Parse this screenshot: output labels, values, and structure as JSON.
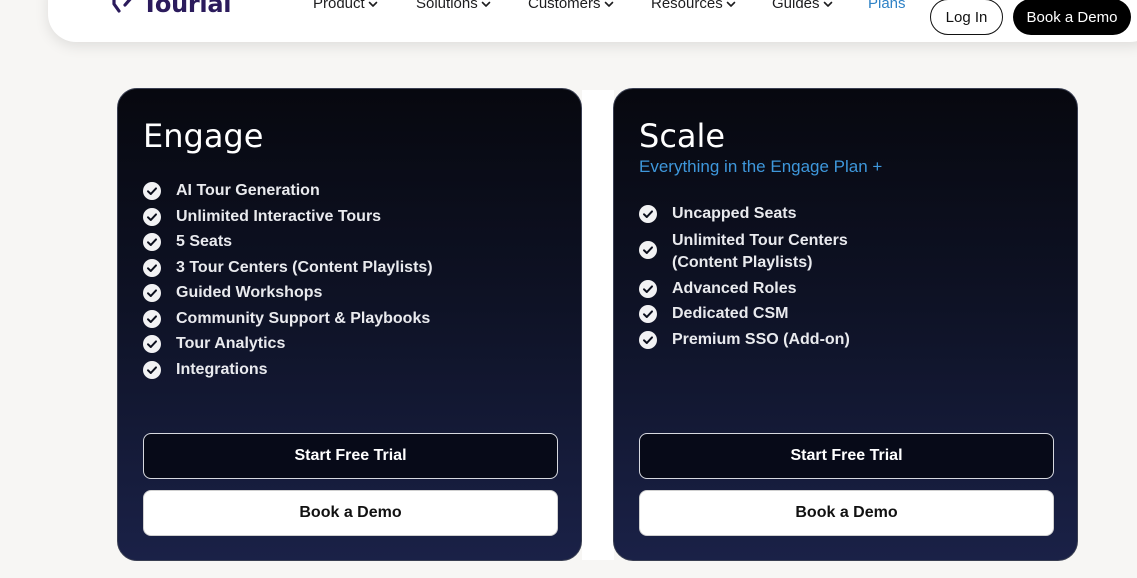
{
  "nav": {
    "logo_text": "Tourial",
    "items": [
      {
        "label": "Product"
      },
      {
        "label": "Solutions"
      },
      {
        "label": "Customers"
      },
      {
        "label": "Resources"
      },
      {
        "label": "Guides"
      }
    ],
    "plans_label": "Plans",
    "login_label": "Log In",
    "book_demo_label": "Book a Demo"
  },
  "plans": [
    {
      "title": "Engage",
      "subtitle": "",
      "features": [
        "AI Tour Generation",
        "Unlimited Interactive Tours",
        "5 Seats",
        "3 Tour Centers (Content Playlists)",
        "Guided Workshops",
        "Community Support & Playbooks",
        "Tour Analytics",
        "Integrations"
      ],
      "trial_label": "Start Free Trial",
      "demo_label": "Book a Demo"
    },
    {
      "title": "Scale",
      "subtitle": "Everything in the Engage Plan +",
      "features": [
        "Uncapped Seats",
        "Unlimited Tour Centers\n(Content Playlists)",
        "Advanced Roles",
        "Dedicated CSM",
        "Premium SSO (Add-on)"
      ],
      "trial_label": "Start Free Trial",
      "demo_label": "Book a Demo"
    }
  ],
  "colors": {
    "brand": "#2b1b5c",
    "plans_link": "#2f82c6",
    "subtitle_accent": "#3e97db",
    "card_bg_top": "#07080f",
    "card_bg_bottom": "#1a2147"
  },
  "icons": {
    "logo": "tourial-logo-icon",
    "dropdown": "chevron-down-icon",
    "feature": "check-circle-icon"
  }
}
